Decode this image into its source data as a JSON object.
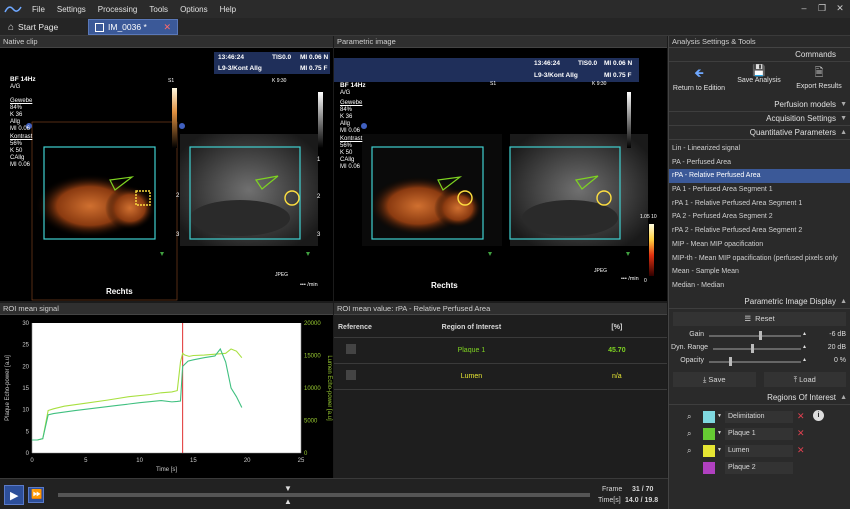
{
  "menubar": {
    "items": [
      "File",
      "Settings",
      "Processing",
      "Tools",
      "Options",
      "Help"
    ]
  },
  "tabs": {
    "start": "Start Page",
    "image": "IM_0036 *"
  },
  "native": {
    "title": "Native clip",
    "time": "13:46:24",
    "tis": "TIS0.0",
    "mi1": "MI 0.06 N",
    "probe": "L9-3/Kont Allg",
    "mi2": "MI 0.75 F",
    "bf": "BF 14Hz",
    "ag": "A/G",
    "s1": "S1",
    "k930": "K 9:30",
    "gewebe": "Gewebe",
    "g1": "84%",
    "g2": "K 36",
    "g3": "Allg",
    "g4": "MI 0.06",
    "kontrast": "Kontrast",
    "c1": "56%",
    "c2": "K 50",
    "c3": "CAllg",
    "c4": "MI 0.06",
    "rechts": "Rechts",
    "jpeg": "JPEG",
    "min": "••• /min",
    "scale": [
      "1",
      "2",
      "3"
    ]
  },
  "param": {
    "title": "Parametric image",
    "scale_top": "1.05 10",
    "scale_bot": "0"
  },
  "signal": {
    "title": "ROI mean signal",
    "ylabel": "Plaque Echo-power [a.u]",
    "y2label": "Lumen Echo-power [a.u]",
    "xlabel": "Time [s]"
  },
  "roi": {
    "title": "ROI mean value: rPA - Relative Perfused Area",
    "headers": [
      "Reference",
      "Region of Interest",
      "[%]"
    ],
    "rows": [
      {
        "name": "Plaque 1",
        "value": "45.70",
        "color": "#7ed321"
      },
      {
        "name": "Lumen",
        "value": "n/a",
        "color": "#e0e040"
      }
    ]
  },
  "right": {
    "title": "Analysis Settings & Tools",
    "commands": "Commands",
    "buttons": [
      {
        "label": "Return to Edition",
        "icon": "arrow-left-icon"
      },
      {
        "label": "Save Analysis",
        "icon": "floppy-icon"
      },
      {
        "label": "Export Results",
        "icon": "document-icon"
      }
    ],
    "perfusion": "Perfusion models",
    "acquisition": "Acquisition Settings",
    "quantitative": "Quantitative Parameters",
    "params": [
      "Lin - Linearized signal",
      "PA - Perfused Area",
      "rPA - Relative Perfused Area",
      "PA 1 - Perfused Area Segment 1",
      "rPA 1 - Relative Perfused Area Segment 1",
      "PA 2 - Perfused Area Segment 2",
      "rPA 2 - Relative Perfused Area Segment 2",
      "MIP - Mean MIP opacification",
      "MIP-th - Mean MIP opacification (perfused pixels only",
      "Mean - Sample Mean",
      "Median - Median"
    ],
    "selected_index": 2,
    "pid": "Parametric Image Display",
    "reset": "Reset",
    "gain_label": "Gain",
    "gain_val": "-6 dB",
    "dyn_label": "Dyn. Range",
    "dyn_val": "20 dB",
    "op_label": "Opacity",
    "op_val": "0 %",
    "save": "Save",
    "load": "Load",
    "rois_title": "Regions Of Interest",
    "rois": [
      {
        "name": "Delimitation",
        "color": "#7fd8e0"
      },
      {
        "name": "Plaque 1",
        "color": "#66cc33"
      },
      {
        "name": "Lumen",
        "color": "#e6e633"
      },
      {
        "name": "Plaque 2",
        "color": "#b040c0"
      }
    ]
  },
  "player": {
    "frame_label": "Frame",
    "frame_val": "31 / 70",
    "time_label": "Time[s]",
    "time_val": "14.0 / 19.8"
  },
  "chart_data": {
    "type": "line",
    "xlabel": "Time [s]",
    "ylabel": "Plaque Echo-power [a.u]",
    "y2label": "Lumen Echo-power [a.u]",
    "xlim": [
      0,
      25
    ],
    "ylim": [
      0,
      30
    ],
    "y2lim": [
      0,
      20000
    ],
    "xticks": [
      0,
      5,
      10,
      15,
      20,
      25
    ],
    "yticks": [
      0,
      5,
      10,
      15,
      20,
      25,
      30
    ],
    "y2ticks": [
      0,
      5000,
      10000,
      15000,
      20000
    ],
    "cursor_x": 14,
    "series": [
      {
        "color": "#a8e040",
        "axis": "left",
        "x": [
          0,
          0.5,
          1,
          1.5,
          2,
          3,
          5,
          7,
          9,
          11,
          12,
          13,
          13.5,
          13.8,
          14,
          14.2,
          14.6,
          15,
          16,
          17,
          18,
          18.5,
          19,
          19.5
        ],
        "y": [
          3,
          3,
          3.3,
          9.8,
          10.2,
          10.8,
          11.5,
          12.2,
          13,
          13.5,
          13.9,
          14.1,
          14.4,
          21,
          23,
          22.6,
          22.3,
          22.5,
          22.6,
          22.8,
          23,
          24,
          23.5,
          22
        ]
      },
      {
        "color": "#40c080",
        "axis": "left",
        "x": [
          0,
          0.5,
          1,
          1.5,
          2,
          4,
          6,
          8,
          10,
          12,
          13,
          13.5,
          13.8,
          14,
          14.5,
          15,
          16,
          17,
          17.5,
          18,
          18.5,
          19,
          19.5
        ],
        "y": [
          3,
          3,
          3.3,
          8.8,
          9.1,
          9.8,
          10.4,
          11,
          11.6,
          12.1,
          11.8,
          11.9,
          12,
          20,
          21.2,
          21.5,
          22,
          22.4,
          24,
          21,
          15,
          13,
          10.5
        ]
      }
    ]
  }
}
